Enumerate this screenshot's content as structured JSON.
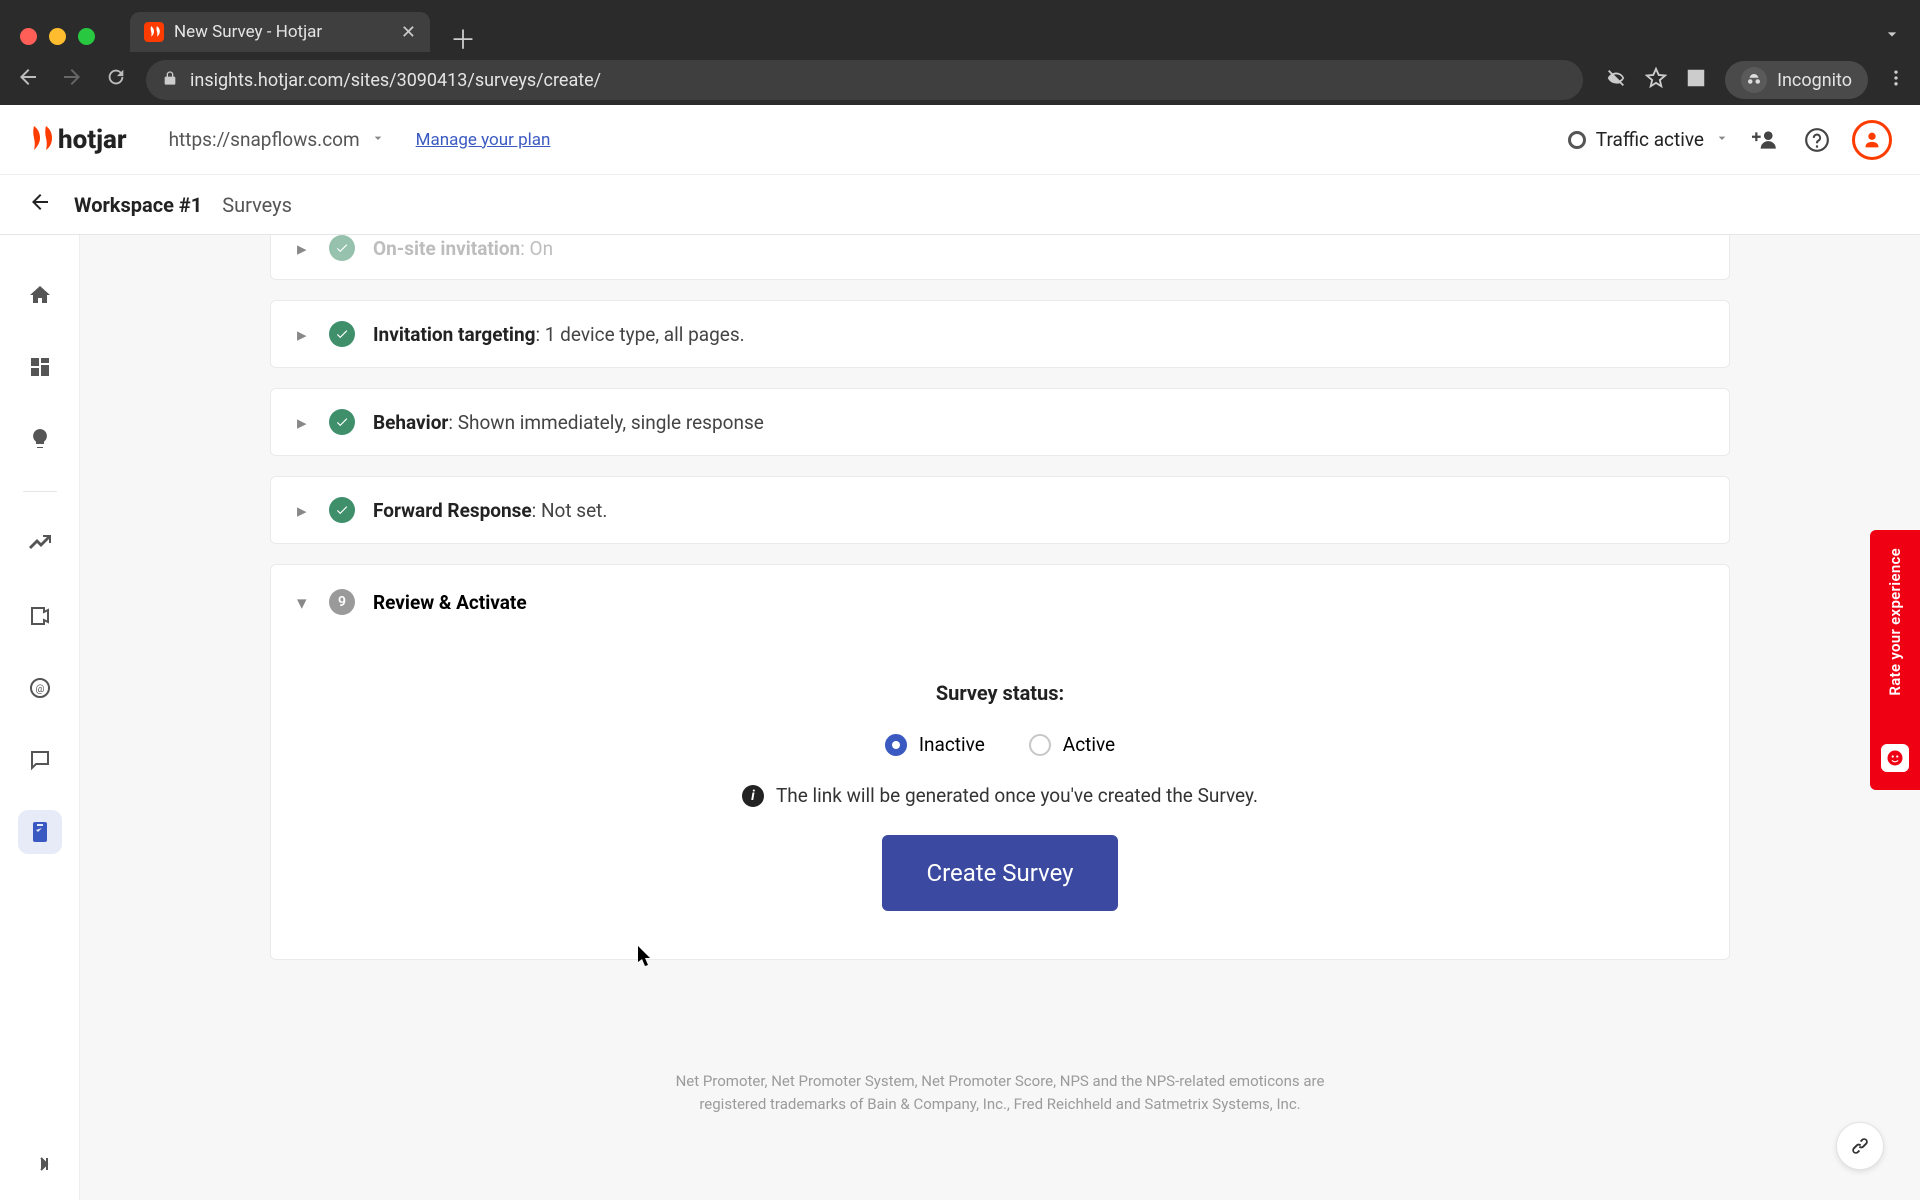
{
  "browser": {
    "tab_title": "New Survey - Hotjar",
    "url": "insights.hotjar.com/sites/3090413/surveys/create/",
    "incognito_label": "Incognito"
  },
  "header": {
    "logo_text": "hotjar",
    "site_url": "https://snapflows.com",
    "manage_plan": "Manage your plan",
    "traffic_label": "Traffic active"
  },
  "breadcrumb": {
    "workspace": "Workspace #1",
    "section": "Surveys"
  },
  "steps": {
    "invitation": {
      "title": "On-site invitation",
      "desc": ": On"
    },
    "targeting": {
      "title": "Invitation targeting",
      "desc": ": 1 device type, all pages."
    },
    "behavior": {
      "title": "Behavior",
      "desc": ": Shown immediately, single response"
    },
    "forward": {
      "title": "Forward Response",
      "desc": ": Not set."
    },
    "review": {
      "number": "9",
      "title": "Review & Activate"
    }
  },
  "review": {
    "status_label": "Survey status:",
    "option_inactive": "Inactive",
    "option_active": "Active",
    "info_text": "The link will be generated once you've created the Survey.",
    "create_button": "Create Survey"
  },
  "footer": {
    "line1": "Net Promoter, Net Promoter System, Net Promoter Score, NPS and the NPS-related emoticons are",
    "line2": "registered trademarks of Bain & Company, Inc., Fred Reichheld and Satmetrix Systems, Inc."
  },
  "feedback": {
    "label": "Rate your experience"
  }
}
